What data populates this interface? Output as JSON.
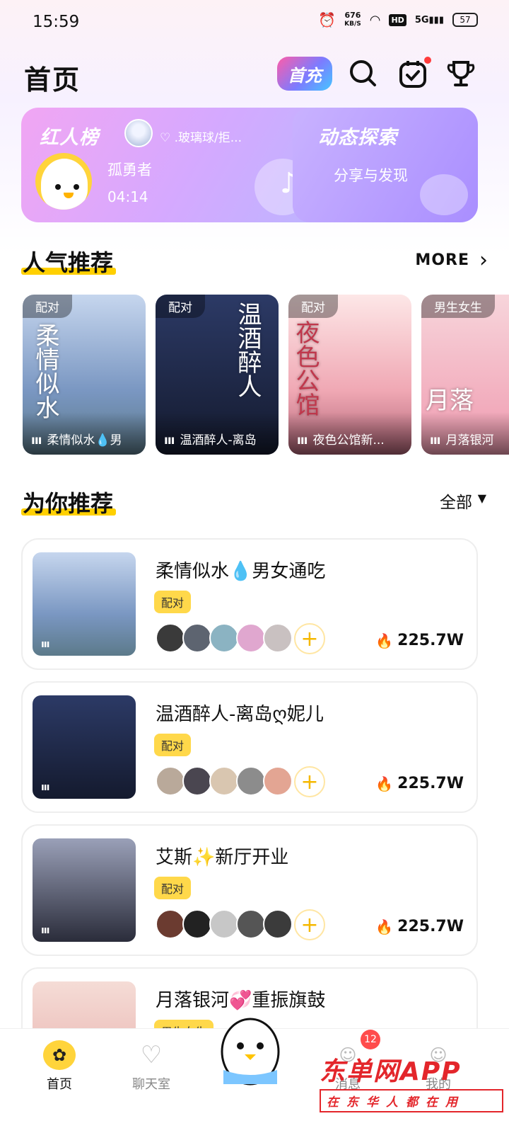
{
  "status_bar": {
    "time": "15:59",
    "speed": "676",
    "speed_unit": "KB/S",
    "hd": "HD",
    "net": "5G",
    "battery": "57"
  },
  "header": {
    "title": "首页",
    "first_recharge": "首充"
  },
  "banner_left": {
    "title": "红人榜",
    "user": "♡ .玻璃球/拒...",
    "name": "孤勇者",
    "time": "04:14"
  },
  "banner_right": {
    "title": "动态探索",
    "subtitle": "分享与发现"
  },
  "popular": {
    "title": "人气推荐",
    "more": "MORE",
    "cards": [
      {
        "tag": "配对",
        "label": "柔情似水💧男",
        "poster": "柔情似水",
        "bg": "#8fb4d9"
      },
      {
        "tag": "配对",
        "label": "温酒醉人-离岛",
        "poster": "温酒醉人",
        "bg": "#1d2540"
      },
      {
        "tag": "配对",
        "label": "夜色公馆新...",
        "poster": "夜色公馆",
        "bg": "#f3c8c8"
      },
      {
        "tag": "男生女生",
        "label": "月落银河",
        "poster": "月落",
        "bg": "#f2b3c0"
      }
    ]
  },
  "for_you": {
    "title": "为你推荐",
    "filter": "全部",
    "rooms": [
      {
        "title": "柔情似水💧男女通吃",
        "tag": "配对",
        "heat": "225.7W",
        "bg": "#8fb4d9"
      },
      {
        "title": "温酒醉人-离岛ღ妮儿",
        "tag": "配对",
        "heat": "225.7W",
        "bg": "#1d2540"
      },
      {
        "title": "艾斯✨新厅开业",
        "tag": "配对",
        "heat": "225.7W",
        "bg": "#2a2c3a"
      },
      {
        "title": "月落银河💞重振旗鼓",
        "tag": "男生女生",
        "heat": "",
        "bg": "#f2c9c9"
      }
    ]
  },
  "nav": {
    "home": "首页",
    "chat": "聊天室",
    "messages": "消息",
    "mine": "我的",
    "messages_badge": "12"
  },
  "watermark": {
    "main": "东单网APP",
    "sub": "在东华人都在用"
  },
  "colors": {
    "accent": "#ffd000",
    "flame": "#ff4a1c",
    "badge": "#ff4c4c"
  }
}
